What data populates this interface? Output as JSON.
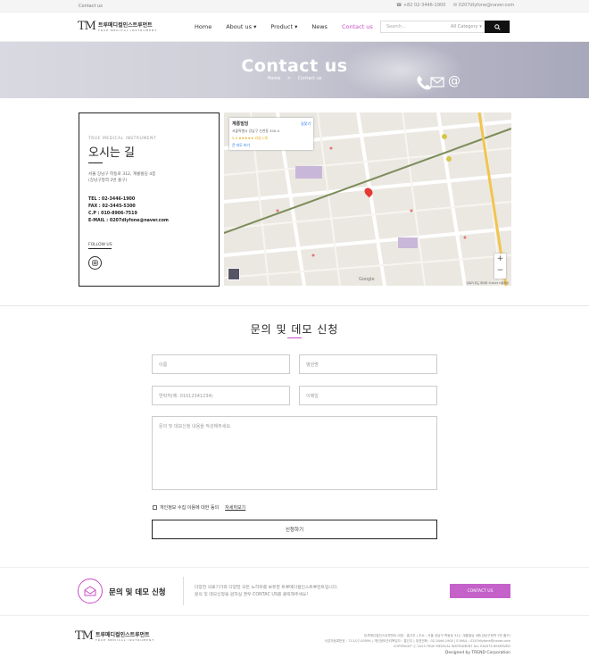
{
  "topbar": {
    "contact_label": "Contact us",
    "phone": "+82 02-3446-1900",
    "email": "0207dlyfone@naver.com"
  },
  "header": {
    "logo_mark": "TM",
    "logo_name": "트루메디컬인스트루먼트",
    "logo_sub": "TRUE MEDICAL INSTRUMENT",
    "nav": [
      "Home",
      "About us",
      "Product",
      "News",
      "Contact us"
    ],
    "nav_active": "Contact us",
    "search_placeholder": "Search...",
    "search_category": "All Category"
  },
  "hero": {
    "title": "Contact us",
    "breadcrumb_home": "Home",
    "breadcrumb_sep": ">",
    "breadcrumb_current": "Contact us"
  },
  "info": {
    "eng": "TRUE MEDICAL INSTRUMENT",
    "title": "오시는 길",
    "address1": "서울 강남구 학동로 312, 계룡빌딩 4층",
    "address2": "(강남구청역 2번 출구)",
    "tel": "TEL : 02-3446-1900",
    "fax": "FAX : 02-3445-5300",
    "cp": "C.P : 010-8906-7519",
    "email": "E-MAIL : 0207dlyfone@naver.com",
    "follow": "FOLLOW US"
  },
  "map": {
    "place_name": "계룡빌딩",
    "place_addr": "서울특별시 강남구 논현동 300-4",
    "rating": "5.0 ★★★★★ 리뷰 1개",
    "larger_map": "큰 지도 보기",
    "directions": "길찾기",
    "zoom_in": "+",
    "zoom_out": "−",
    "google": "Google",
    "terms": "단축키  지도 데이터 ©2023  이용약관"
  },
  "form": {
    "title": "문의 및 데모 신청",
    "name_ph": "이름",
    "hospital_ph": "병원명",
    "phone_ph": "연락처(예: 01012341234)",
    "email_ph": "이메일",
    "message_ph": "문의 및 데모신청 내용을 작성해주세요.",
    "privacy_label": "개인정보 수집 이용에 대한 동의",
    "privacy_link": "자세히보기",
    "submit": "신청하기"
  },
  "cta": {
    "label": "문의 및 데모 신청",
    "desc1": "다양한 의료기기와 다양한 모든 노하우를 보유한 트루메디컬인스트루먼트입니다.",
    "desc2": "문의 및 데모신청을 원하실 경우 CONTAC US를 클릭해주세요!",
    "button": "CONTACT US"
  },
  "footer": {
    "logo_mark": "TM",
    "logo_name": "트루메디컬인스트루먼트",
    "logo_sub": "TRUE MEDICAL INSTRUMENT",
    "line1": "트루메디컬인스트루먼트 대표 : 홍선우 | 주소 : 서울 강남구 학동로 312, 계룡빌딩 4층(강남구청역 2번 출구)",
    "line2": "사업자등록번호 : 713-07-00594 | 개인정보관리책임자 : 홍선우 | 대표전화 : 02-3446-1900 | E-MAIL : 0207dlyfone@naver.com",
    "line3": "COPYRIGHT ⓒ 2023 TRUE MEDICAL INSTRUMENT ALL RIGHTS RESERVED",
    "designed": "Designed by TREND Corporation"
  },
  "colors": {
    "accent": "#c94fc8",
    "cta_button": "#c462c9"
  }
}
